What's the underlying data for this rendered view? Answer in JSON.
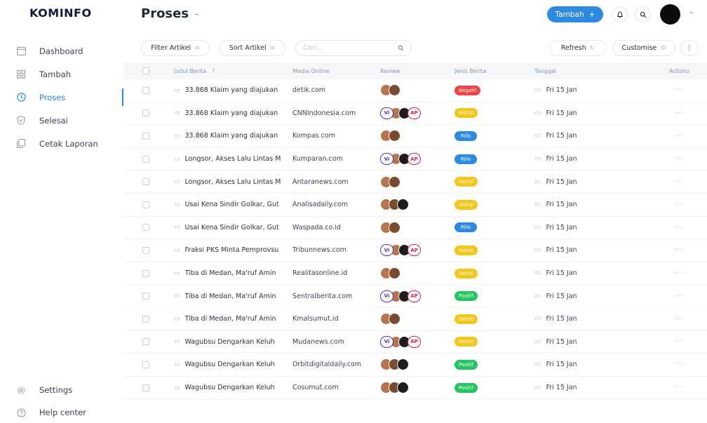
{
  "app": {
    "logo": "KOMINFO"
  },
  "sidebar": {
    "items": [
      {
        "label": "Dashboard",
        "icon": "window-icon",
        "active": false
      },
      {
        "label": "Tambah",
        "icon": "grid-icon",
        "active": false
      },
      {
        "label": "Proses",
        "icon": "clock-icon",
        "active": true
      },
      {
        "label": "Selesai",
        "icon": "shield-check-icon",
        "active": false
      },
      {
        "label": "Cetak Laporan",
        "icon": "copy-icon",
        "active": false
      }
    ],
    "bottom": [
      {
        "label": "Settings",
        "icon": "gear-icon"
      },
      {
        "label": "Help center",
        "icon": "help-icon"
      }
    ]
  },
  "header": {
    "title": "Proses",
    "title_caret": "-",
    "primary_button": "Tambah",
    "primary_button_icon": "+",
    "bell_icon": "bell-icon",
    "search_icon": "search-icon"
  },
  "toolbar": {
    "filter_label": "Filter Artikel",
    "sort_label": "Sort Artikel",
    "search_placeholder": "Cari...",
    "refresh_label": "Refresh",
    "customise_label": "Customise",
    "more_label": "⋮"
  },
  "table": {
    "headers": {
      "judul": "Judul Berita",
      "judul_sort": "↑",
      "media": "Media Online",
      "review": "Review",
      "jenis": "Jenis Berita",
      "tanggal": "Tanggal",
      "actions": "Actions"
    },
    "colors": {
      "Negatif": "#ef4444",
      "Netral": "#f5c518",
      "Rilis": "#2d8ae2",
      "Positif": "#22c55e",
      "chip_vi": "#4338ca",
      "chip_ap": "#e11d48"
    },
    "rows": [
      {
        "title": "33.868 Klaim yang diajukan",
        "media": "detik.com",
        "review": "faces2",
        "jenis": "Negatif",
        "date": "Fri 15 Jan",
        "actions": "···"
      },
      {
        "title": "33.868 Klaim yang diajukan",
        "media": "CNNIndonesia.com",
        "review": "vi-ap",
        "jenis": "Netral",
        "date": "Fri 15 Jan",
        "actions": "···"
      },
      {
        "title": "33.868 Klaim yang diajukan",
        "media": "Kompas.com",
        "review": "faces2",
        "jenis": "Rilis",
        "date": "Fri 15 Jan",
        "actions": "···"
      },
      {
        "title": "Longsor, Akses Lalu Lintas M",
        "media": "Kumparan.com",
        "review": "vi-ap",
        "jenis": "Rilis",
        "date": "Fri 15 Jan",
        "actions": "···"
      },
      {
        "title": "Longsor, Akses Lalu Lintas M",
        "media": "Antaranews.com",
        "review": "faces2",
        "jenis": "Netral",
        "date": "Fri 15 Jan",
        "actions": "···"
      },
      {
        "title": "Usai Kena Sindir Golkar, Gut",
        "media": "Analisadaily.com",
        "review": "faces3",
        "jenis": "Netral",
        "date": "Fri 15 Jan",
        "actions": "···"
      },
      {
        "title": "Usai Kena Sindir Golkar, Gut",
        "media": "Waspada.co.id",
        "review": "faces2",
        "jenis": "Rilis",
        "date": "Fri 15 Jan",
        "actions": "···"
      },
      {
        "title": "Fraksi PKS Minta Pemprovsu",
        "media": "Tribunnews.com",
        "review": "vi-ap",
        "jenis": "Netral",
        "date": "Fri 15 Jan",
        "actions": "···"
      },
      {
        "title": "Tiba di Medan, Ma'ruf Amin",
        "media": "Realitasonline.id",
        "review": "faces2",
        "jenis": "Netral",
        "date": "Fri 15 Jan",
        "actions": "···"
      },
      {
        "title": "Tiba di Medan, Ma'ruf Amin",
        "media": "Sentralberita.com",
        "review": "vi-ap",
        "jenis": "Positif",
        "date": "Fri 15 Jan",
        "actions": "···"
      },
      {
        "title": "Tiba di Medan, Ma'ruf Amin",
        "media": "Kmalsumut.id",
        "review": "faces2",
        "jenis": "Netral",
        "date": "Fri 15 Jan",
        "actions": "···"
      },
      {
        "title": "Wagubsu Dengarkan Keluh",
        "media": "Mudanews.com",
        "review": "vi-ap",
        "jenis": "Netral",
        "date": "Fri 15 Jan",
        "actions": "···"
      },
      {
        "title": "Wagubsu Dengarkan Keluh",
        "media": "Orbitdigitaldaily.com",
        "review": "faces3",
        "jenis": "Positif",
        "date": "Fri 15 Jan",
        "actions": "···"
      },
      {
        "title": "Wagubsu Dengarkan Keluh",
        "media": "Cosumut.com",
        "review": "faces3",
        "jenis": "Positif",
        "date": "Fri 15 Jan",
        "actions": "···"
      }
    ],
    "chips": {
      "vi": "Vi",
      "ap": "AP"
    }
  }
}
